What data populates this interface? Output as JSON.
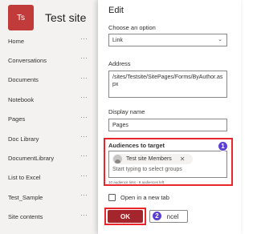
{
  "site": {
    "logo_text": "Ts",
    "title": "Test site",
    "logo_color": "#c23b3b"
  },
  "nav": {
    "more_label": "···",
    "items": [
      {
        "label": "Home"
      },
      {
        "label": "Conversations"
      },
      {
        "label": "Documents"
      },
      {
        "label": "Notebook"
      },
      {
        "label": "Pages"
      },
      {
        "label": "Doc Library"
      },
      {
        "label": "DocumentLibrary"
      },
      {
        "label": "List to Excel"
      },
      {
        "label": "Test_Sample"
      },
      {
        "label": "Site contents"
      }
    ]
  },
  "panel": {
    "title": "Edit",
    "option_label": "Choose an option",
    "option_value": "Link",
    "address_label": "Address",
    "address_value": "/sites/Testsite/SitePages/Forms/ByAuthor.aspx",
    "display_label": "Display name",
    "display_value": "Pages",
    "audiences_label": "Audiences to target",
    "audience_chip": "Test site Members",
    "audience_placeholder": "Start typing to select groups",
    "audience_hint": "10 audience limit - 9 audiences left",
    "new_tab_label": "Open in a new tab",
    "ok_label": "OK",
    "cancel_label": "ncel"
  },
  "annotations": {
    "step1": "1",
    "step2": "2"
  },
  "colors": {
    "highlight": "#e8262b",
    "ok_button": "#a4262c",
    "badge": "#5b3fd3"
  }
}
